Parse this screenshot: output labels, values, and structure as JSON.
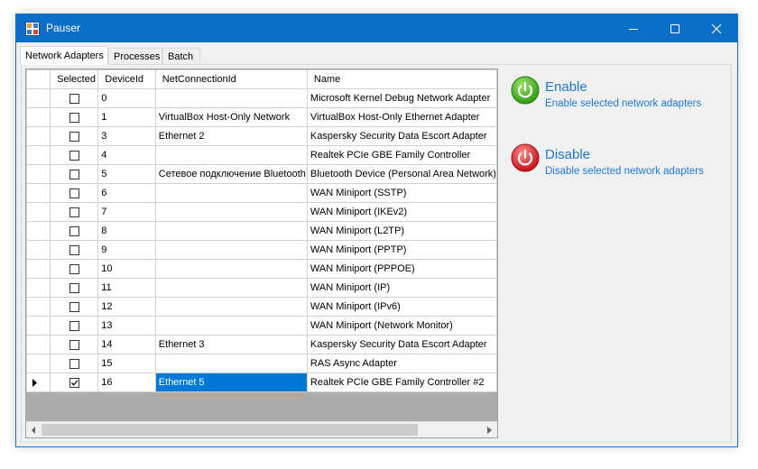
{
  "window": {
    "title": "Pauser"
  },
  "tabs": [
    {
      "label": "Network Adapters",
      "active": true
    },
    {
      "label": "Processes",
      "active": false
    },
    {
      "label": "Batch",
      "active": false
    }
  ],
  "grid": {
    "columns": [
      "Selected",
      "DeviceId",
      "NetConnectionId",
      "Name"
    ],
    "rows": [
      {
        "selected": false,
        "device_id": "0",
        "net_connection_id": "",
        "name": "Microsoft Kernel Debug Network Adapter"
      },
      {
        "selected": false,
        "device_id": "1",
        "net_connection_id": "VirtualBox Host-Only Network",
        "name": "VirtualBox Host-Only Ethernet Adapter"
      },
      {
        "selected": false,
        "device_id": "3",
        "net_connection_id": "Ethernet 2",
        "name": "Kaspersky Security Data Escort Adapter"
      },
      {
        "selected": false,
        "device_id": "4",
        "net_connection_id": "",
        "name": "Realtek PCIe GBE Family Controller"
      },
      {
        "selected": false,
        "device_id": "5",
        "net_connection_id": "Сетевое подключение Bluetooth",
        "name": "Bluetooth Device (Personal Area Network)"
      },
      {
        "selected": false,
        "device_id": "6",
        "net_connection_id": "",
        "name": "WAN Miniport (SSTP)"
      },
      {
        "selected": false,
        "device_id": "7",
        "net_connection_id": "",
        "name": "WAN Miniport (IKEv2)"
      },
      {
        "selected": false,
        "device_id": "8",
        "net_connection_id": "",
        "name": "WAN Miniport (L2TP)"
      },
      {
        "selected": false,
        "device_id": "9",
        "net_connection_id": "",
        "name": "WAN Miniport (PPTP)"
      },
      {
        "selected": false,
        "device_id": "10",
        "net_connection_id": "",
        "name": "WAN Miniport (PPPOE)"
      },
      {
        "selected": false,
        "device_id": "11",
        "net_connection_id": "",
        "name": "WAN Miniport (IP)"
      },
      {
        "selected": false,
        "device_id": "12",
        "net_connection_id": "",
        "name": "WAN Miniport (IPv6)"
      },
      {
        "selected": false,
        "device_id": "13",
        "net_connection_id": "",
        "name": "WAN Miniport (Network Monitor)"
      },
      {
        "selected": false,
        "device_id": "14",
        "net_connection_id": "Ethernet 3",
        "name": "Kaspersky Security Data Escort Adapter"
      },
      {
        "selected": false,
        "device_id": "15",
        "net_connection_id": "",
        "name": "RAS Async Adapter"
      },
      {
        "selected": true,
        "device_id": "16",
        "net_connection_id": "Ethernet 5",
        "name": "Realtek PCIe GBE Family Controller #2",
        "current": true
      }
    ]
  },
  "actions": {
    "enable": {
      "label": "Enable",
      "description": "Enable selected network adapters",
      "color": "#3cb01e"
    },
    "disable": {
      "label": "Disable",
      "description": "Disable selected network adapters",
      "color": "#e0202a"
    }
  },
  "colors": {
    "titlebar": "#0b6ec9",
    "link": "#1e78d2",
    "selection": "#0078d7"
  }
}
